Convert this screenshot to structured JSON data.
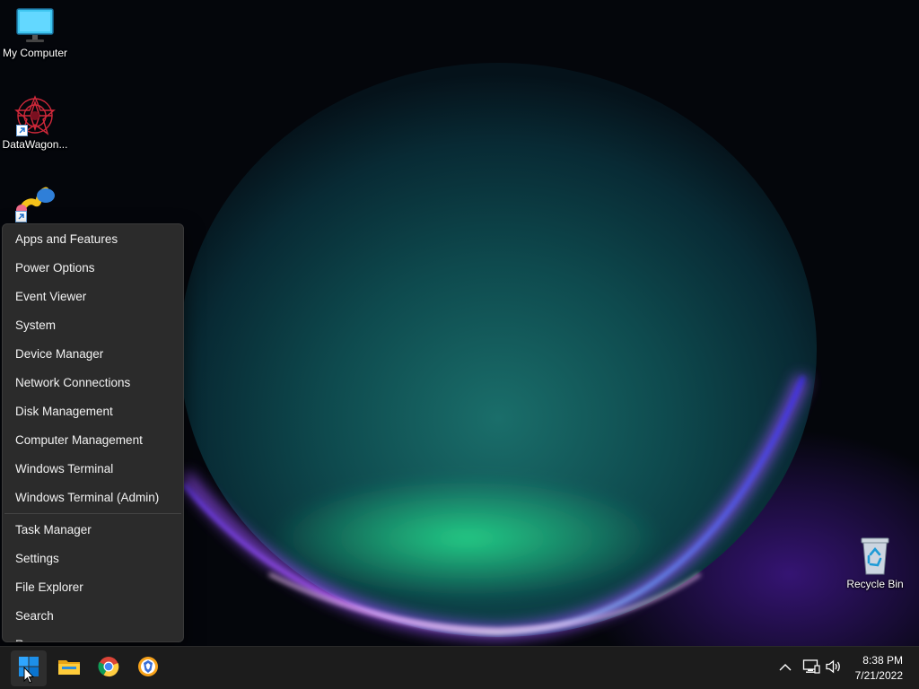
{
  "desktop": {
    "icons": [
      {
        "label": "My Computer",
        "icon": "monitor-icon"
      },
      {
        "label": "DataWagon...",
        "icon": "datawagon-logo-icon"
      },
      {
        "label": "",
        "icon": "app-shortcut-icon"
      },
      {
        "label": "Recycle Bin",
        "icon": "recycle-bin-icon"
      }
    ]
  },
  "context_menu": {
    "group1": [
      "Apps and Features",
      "Power Options",
      "Event Viewer",
      "System",
      "Device Manager",
      "Network Connections",
      "Disk Management",
      "Computer Management",
      "Windows Terminal",
      "Windows Terminal (Admin)"
    ],
    "group2": [
      "Task Manager",
      "Settings",
      "File Explorer",
      "Search",
      "Run"
    ]
  },
  "taskbar": {
    "pinned": [
      "windows-start-icon",
      "file-explorer-icon",
      "chrome-icon",
      "brave-browser-icon"
    ],
    "tray": [
      "chevron-up-icon",
      "network-icon",
      "volume-icon"
    ],
    "clock": {
      "time": "8:38 PM",
      "date": "7/21/2022"
    }
  },
  "colors": {
    "menu_bg": "#2b2b2b",
    "taskbar_bg": "#1c1c1c",
    "accent": "#0078d4"
  }
}
